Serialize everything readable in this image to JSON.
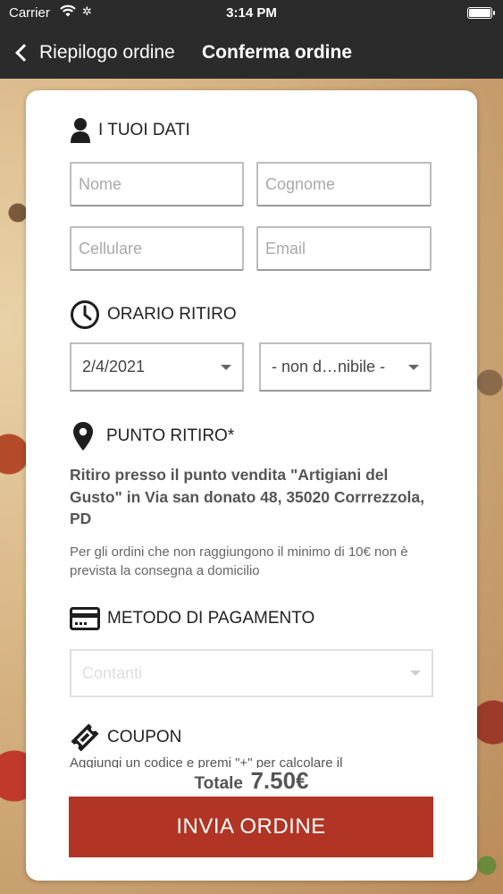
{
  "status_bar": {
    "carrier": "Carrier",
    "time": "3:14 PM"
  },
  "nav": {
    "back_label": "Riepilogo ordine",
    "title": "Conferma ordine"
  },
  "personal": {
    "title": "I TUOI DATI",
    "first_name_placeholder": "Nome",
    "last_name_placeholder": "Cognome",
    "phone_placeholder": "Cellulare",
    "email_placeholder": "Email"
  },
  "pickup_time": {
    "title": "ORARIO RITIRO",
    "date_value": "2/4/2021",
    "time_value": "- non d…nibile -"
  },
  "pickup_point": {
    "title": "PUNTO RITIRO*",
    "address": "Ritiro presso il punto vendita \"Artigiani del Gusto\" in Via san donato 48, 35020 Corrrezzola, PD",
    "note": "Per gli ordini che non raggiungono il minimo di 10€ non è prevista la consegna a domicilio"
  },
  "payment": {
    "title": "METODO DI PAGAMENTO",
    "selected": "Contanti"
  },
  "coupon": {
    "title": "COUPON",
    "hint": "Aggiungi un codice e premi \"+\" per calcolare il"
  },
  "summary": {
    "total_label": "Totale",
    "total_amount": "7.50€"
  },
  "submit_label": "INVIA ORDINE",
  "colors": {
    "bar_background": "#2b2b2b",
    "accent": "#b23424",
    "card": "#ffffff"
  },
  "icons": [
    "wifi-icon",
    "settings-icon",
    "battery-icon",
    "back-chevron-icon",
    "user-icon",
    "clock-icon",
    "location-pin-icon",
    "credit-card-icon",
    "ticket-icon",
    "dropdown-caret-icon"
  ]
}
